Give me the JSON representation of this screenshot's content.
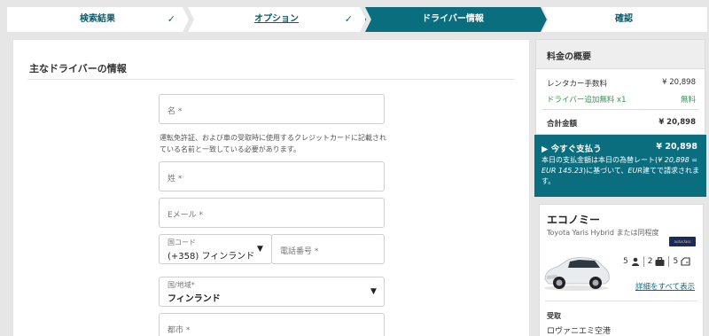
{
  "steps": [
    {
      "label": "検索結果",
      "done": "✓"
    },
    {
      "label": "オプション",
      "done": "✓"
    },
    {
      "label": "ドライバー情報"
    },
    {
      "label": "確認"
    }
  ],
  "form": {
    "title": "主なドライバーの情報",
    "first_name_placeholder": "名 *",
    "help_text": "運転免許証、および車の受取時に使用するクレジットカードに記載されている名前と一致している必要があります。",
    "last_name_placeholder": "姓 *",
    "email_placeholder": "Eメール *",
    "country_code_label": "国コード",
    "country_code_value": "(+358) フィンランド",
    "phone_placeholder": "電話番号 *",
    "region_label": "国/地域*",
    "region_value": "フィンランド",
    "city_placeholder": "都市 *"
  },
  "summary": {
    "title": "料金の概要",
    "rental_fee_label": "レンタカー手数料",
    "rental_fee_value": "¥ 20,898",
    "extra_driver_label": "ドライバー追加無料 x1",
    "extra_driver_value": "無料",
    "total_label": "合計金額",
    "total_value": "¥ 20,898"
  },
  "pay_now": {
    "title": "今すぐ支払う",
    "amount": "¥ 20,898",
    "desc_1": "本日の支払金額は本日の為替レート(",
    "desc_rate": "¥ 20,898 = EUR 145.23",
    "desc_2": ")に基づいて、",
    "desc_currency": "EUR",
    "desc_3": "建てで請求されます。"
  },
  "car": {
    "class": "エコノミー",
    "model": "Toyota Yaris Hybrid または同程度",
    "supplier_logo_text": "autoclass",
    "seats": "5",
    "bags": "2",
    "doors": "5",
    "details_link": "詳細をすべて表示",
    "pickup_label": "受取",
    "pickup_location": "ロヴァニエミ空港"
  },
  "colors": {
    "accent": "#0b6e7f",
    "free": "#2e9a4a"
  }
}
